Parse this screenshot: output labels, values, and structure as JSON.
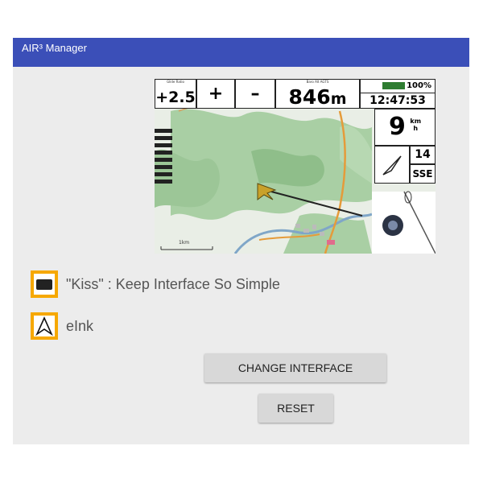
{
  "window": {
    "title": "AIR³ Manager"
  },
  "preview": {
    "vario": {
      "caption": "Glide Ratio",
      "value": "+2.5"
    },
    "plus_label": "+",
    "minus_label": "–",
    "altitude": {
      "caption": "Baro Alt AGTS",
      "value": "846",
      "unit": "m"
    },
    "battery": "100%",
    "clock": "12:47:53",
    "speed": {
      "value": "9",
      "unit_top": "km",
      "unit_bottom": "h"
    },
    "wind": {
      "value": "14",
      "direction": "SSE"
    },
    "scale_label": "1km",
    "colors": {
      "map_green": "#a9cfa4",
      "map_light": "#e9eee6",
      "river": "#7fa6c8",
      "road": "#e59b3a"
    }
  },
  "interfaces": [
    {
      "label": "\"Kiss\" : Keep Interface So Simple",
      "icon": "kiss-screen-icon"
    },
    {
      "label": "eInk",
      "icon": "navigation-arrow-icon"
    }
  ],
  "actions": {
    "change_interface": "CHANGE INTERFACE",
    "reset": "RESET"
  },
  "theme": {
    "titlebar": "#3b4fb8",
    "background": "#ececec",
    "accent": "#f6a800",
    "button": "#d8d8d8"
  }
}
